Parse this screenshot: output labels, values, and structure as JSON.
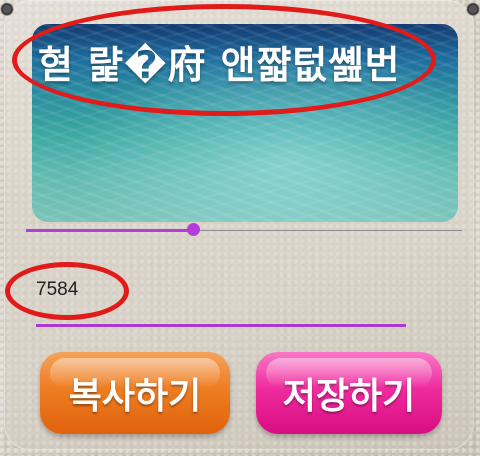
{
  "banner": {
    "title": "혇 럁�府 앤쨟텂쏊번"
  },
  "slider": {
    "value_fraction": 0.35
  },
  "value_field": {
    "value": "7584"
  },
  "buttons": {
    "copy_label": "복사하기",
    "save_label": "저장하기"
  },
  "colors": {
    "accent": "#b43cd8",
    "annotation": "#e11a1a",
    "copy_button": "#ee7d22",
    "save_button": "#ef2b9e"
  }
}
